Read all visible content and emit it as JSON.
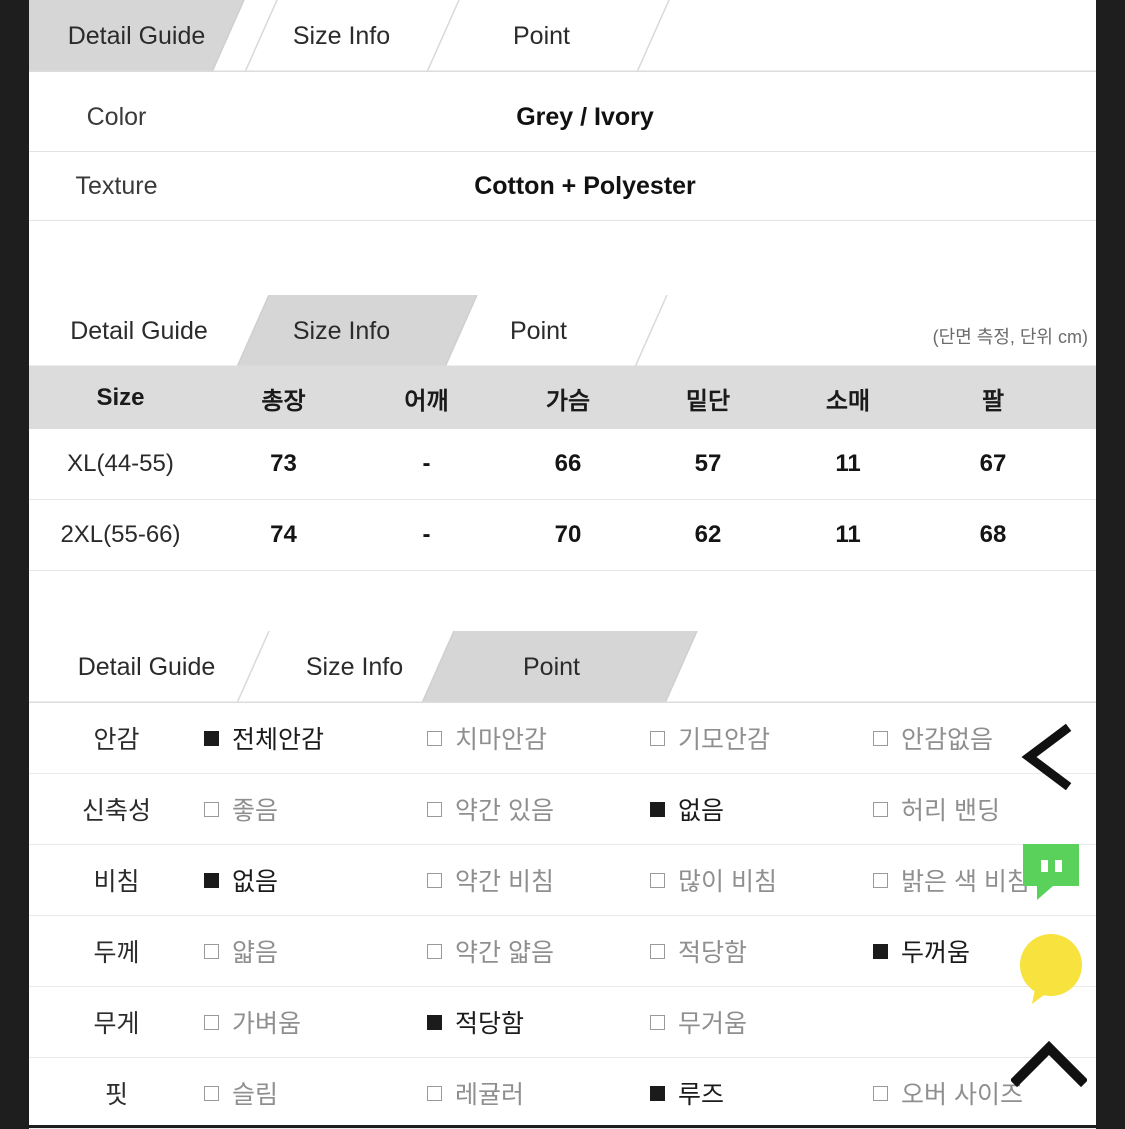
{
  "sections": {
    "detail_guide": {
      "tabs": [
        {
          "label": "Detail Guide",
          "active": true
        },
        {
          "label": "Size Info",
          "active": false
        },
        {
          "label": "Point",
          "active": false
        }
      ],
      "rows": [
        {
          "label": "Color",
          "value": "Grey / Ivory"
        },
        {
          "label": "Texture",
          "value": "Cotton + Polyester"
        }
      ]
    },
    "size_info": {
      "tabs": [
        {
          "label": "Detail Guide",
          "active": false
        },
        {
          "label": "Size Info",
          "active": true
        },
        {
          "label": "Point",
          "active": false
        }
      ],
      "unit_note": "(단면 측정, 단위 cm)",
      "headers": [
        "Size",
        "총장",
        "어깨",
        "가슴",
        "밑단",
        "소매",
        "팔"
      ],
      "rows": [
        [
          "XL(44-55)",
          "73",
          "-",
          "66",
          "57",
          "11",
          "67"
        ],
        [
          "2XL(55-66)",
          "74",
          "-",
          "70",
          "62",
          "11",
          "68"
        ]
      ]
    },
    "point": {
      "tabs": [
        {
          "label": "Detail Guide",
          "active": false
        },
        {
          "label": "Size Info",
          "active": false
        },
        {
          "label": "Point",
          "active": true
        }
      ],
      "rows": [
        {
          "label": "안감",
          "options": [
            {
              "text": "전체안감",
              "checked": true
            },
            {
              "text": "치마안감",
              "checked": false
            },
            {
              "text": "기모안감",
              "checked": false
            },
            {
              "text": "안감없음",
              "checked": false
            }
          ]
        },
        {
          "label": "신축성",
          "options": [
            {
              "text": "좋음",
              "checked": false
            },
            {
              "text": "약간 있음",
              "checked": false
            },
            {
              "text": "없음",
              "checked": true
            },
            {
              "text": "허리 밴딩",
              "checked": false
            }
          ]
        },
        {
          "label": "비침",
          "options": [
            {
              "text": "없음",
              "checked": true
            },
            {
              "text": "약간 비침",
              "checked": false
            },
            {
              "text": "많이 비침",
              "checked": false
            },
            {
              "text": "밝은 색 비침",
              "checked": false
            }
          ]
        },
        {
          "label": "두께",
          "options": [
            {
              "text": "얇음",
              "checked": false
            },
            {
              "text": "약간 얇음",
              "checked": false
            },
            {
              "text": "적당함",
              "checked": false
            },
            {
              "text": "두꺼움",
              "checked": true
            }
          ]
        },
        {
          "label": "무게",
          "options": [
            {
              "text": "가벼움",
              "checked": false
            },
            {
              "text": "적당함",
              "checked": true
            },
            {
              "text": "무거움",
              "checked": false
            },
            {
              "text": "",
              "checked": false
            }
          ]
        },
        {
          "label": "핏",
          "options": [
            {
              "text": "슬림",
              "checked": false
            },
            {
              "text": "레귤러",
              "checked": false
            },
            {
              "text": "루즈",
              "checked": true
            },
            {
              "text": "오버 사이즈",
              "checked": false
            }
          ]
        }
      ]
    }
  },
  "overlay": {
    "chevron_left_icon": "chevron-left",
    "chevron_up_icon": "chevron-up",
    "chat_bubble_icon": "chat-bubble",
    "yellow_bubble_icon": "speech-bubble",
    "colors": {
      "green": "#5ad15a",
      "yellow": "#f7e23e",
      "active_tab": "#d6d6d6",
      "header_row": "#dcdcdc"
    }
  }
}
